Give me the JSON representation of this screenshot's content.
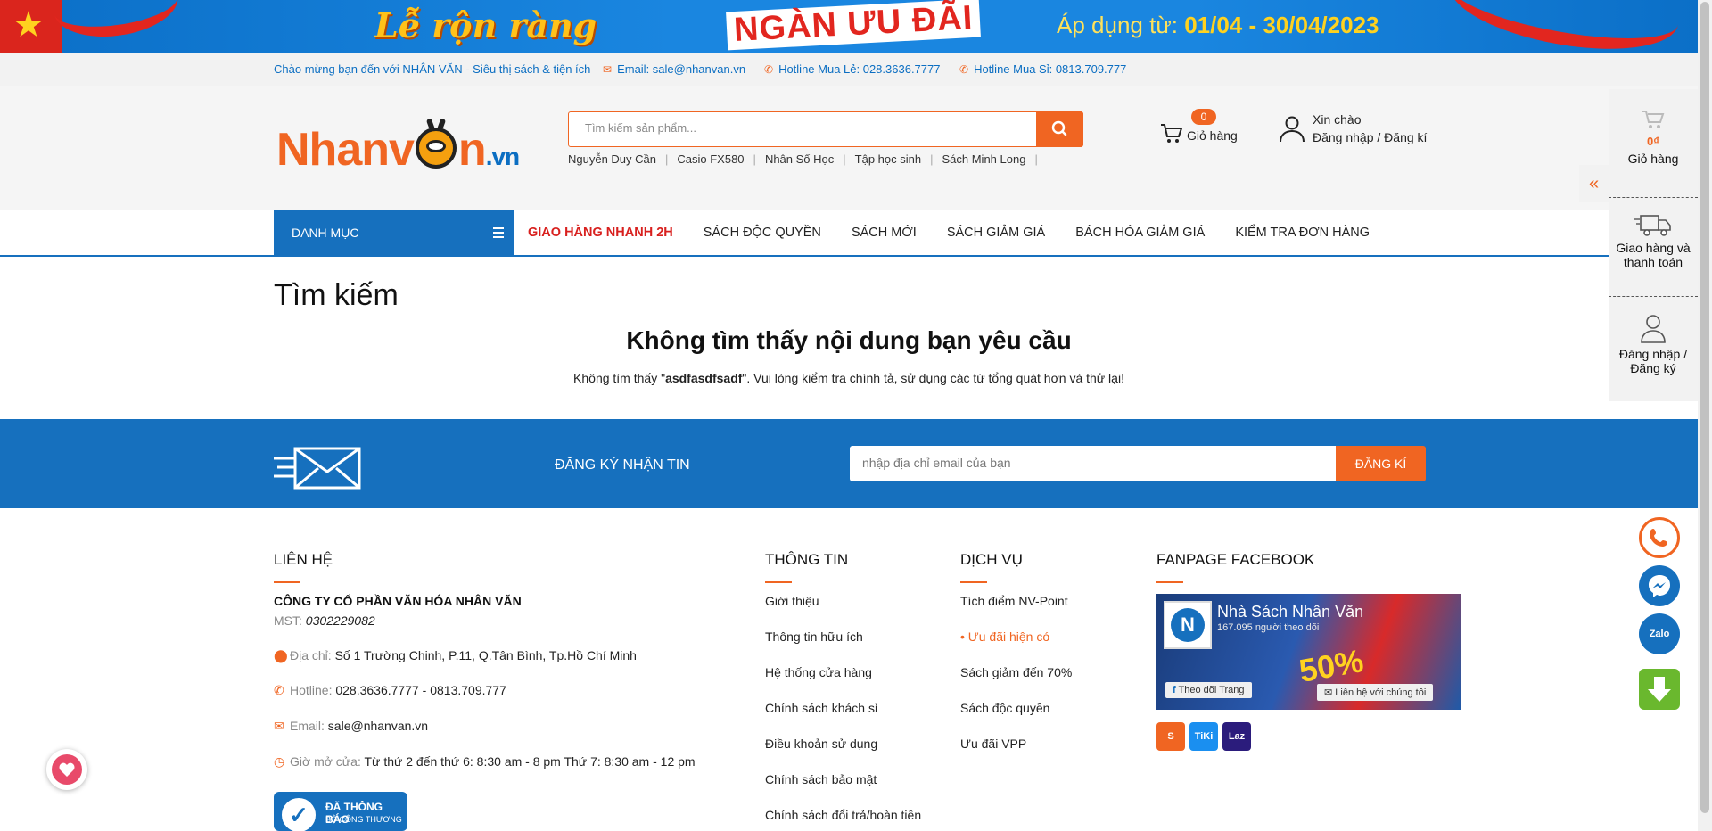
{
  "promo": {
    "title_left": "Lễ rộn ràng",
    "title_mid": "NGÀN ƯU ĐÃI",
    "apply_prefix": "Áp dụng từ:",
    "apply_dates": "01/04 - 30/04/2023"
  },
  "topbar": {
    "welcome": "Chào mừng bạn đến với NHÂN VĂN - Siêu thị sách & tiện ích",
    "email": "Email: sale@nhanvan.vn",
    "hotline_retail": "Hotline Mua Lẻ: 028.3636.7777",
    "hotline_wholesale": "Hotline Mua Sỉ: 0813.709.777"
  },
  "header": {
    "logo_left": "Nhanv",
    "logo_right": "n",
    "logo_suffix": ".vn",
    "search_placeholder": "Tìm kiếm sản phẩm...",
    "suggestions": [
      "Nguyễn Duy Cần",
      "Casio FX580",
      "Nhân Số Học",
      "Tập học sinh",
      "Sách Minh Long"
    ],
    "cart_count": "0",
    "cart_label": "Giỏ hàng",
    "hello": "Xin chào",
    "login": "Đăng nhập / Đăng kí"
  },
  "nav": {
    "category": "DANH MỤC",
    "links": [
      "GIAO HÀNG NHANH 2H",
      "SÁCH ĐỘC QUYỀN",
      "SÁCH MỚI",
      "SÁCH GIẢM GIÁ",
      "BÁCH HÓA GIẢM GIÁ",
      "KIỂM TRA ĐƠN HÀNG"
    ]
  },
  "main": {
    "title": "Tìm kiếm",
    "not_found_heading": "Không tìm thấy nội dung bạn yêu cầu",
    "not_found_prefix": "Không tìm thấy \"",
    "query": "asdfasdfsadf",
    "not_found_suffix": "\". Vui lòng kiểm tra chính tả, sử dụng các từ tổng quát hơn và thử lại!"
  },
  "newsletter": {
    "label": "ĐĂNG KÝ NHẬN TIN",
    "placeholder": "nhập địa chỉ email của bạn",
    "button": "ĐĂNG KÍ"
  },
  "footer": {
    "contact_title": "LIÊN HỆ",
    "company": "CÔNG TY CỔ PHẦN VĂN HÓA NHÂN VĂN",
    "mst_label": "MST:",
    "mst_value": "0302229082",
    "address_label": "Địa chỉ:",
    "address": "Số 1 Trường Chinh, P.11, Q.Tân Bình, Tp.Hồ Chí Minh",
    "hotline_label": "Hotline:",
    "hotline": "028.3636.7777 - 0813.709.777",
    "email_label": "Email:",
    "email": "sale@nhanvan.vn",
    "hours_label": "Giờ mở cửa:",
    "hours": "Từ thứ 2 đến thứ 6: 8:30 am - 8 pm Thứ 7: 8:30 am - 12 pm",
    "bct_line1": "ĐÃ THÔNG BÁO",
    "bct_line2": "BỘ CÔNG THƯƠNG",
    "info_title": "THÔNG TIN",
    "info_links": [
      "Giới thiệu",
      "Thông tin hữu ích",
      "Hệ thống cửa hàng",
      "Chính sách khách sỉ",
      "Điều khoản sử dụng",
      "Chính sách bảo mật",
      "Chính sách đổi trả/hoàn tiền"
    ],
    "service_title": "DỊCH VỤ",
    "service_links": [
      "Tích điểm NV-Point",
      "Ưu đãi hiện có",
      "Sách giảm đến 70%",
      "Sách độc quyền",
      "Ưu đãi VPP"
    ],
    "fanpage_title": "FANPAGE FACEBOOK",
    "fb_name": "Nhà Sách Nhân Văn",
    "fb_followers": "167.095 người theo dõi",
    "fb_follow": "Theo dõi Trang",
    "fb_contact": "Liên hệ với chúng tôi",
    "fb_sale": "50%",
    "shops": [
      "Shopee",
      "Tiki",
      "Lazada"
    ],
    "shop_labels": [
      "S",
      "TiKi",
      "Laz"
    ]
  },
  "side_panel": {
    "cart_price": "0₫",
    "cart_label": "Giỏ hàng",
    "shipping": "Giao hàng và thanh toán",
    "login": "Đăng nhập / Đăng ký"
  },
  "floating": {
    "zalo": "Zalo"
  },
  "colors": {
    "brand_orange": "#f06522",
    "brand_blue": "#1670be",
    "hot_red": "#d8201e"
  }
}
